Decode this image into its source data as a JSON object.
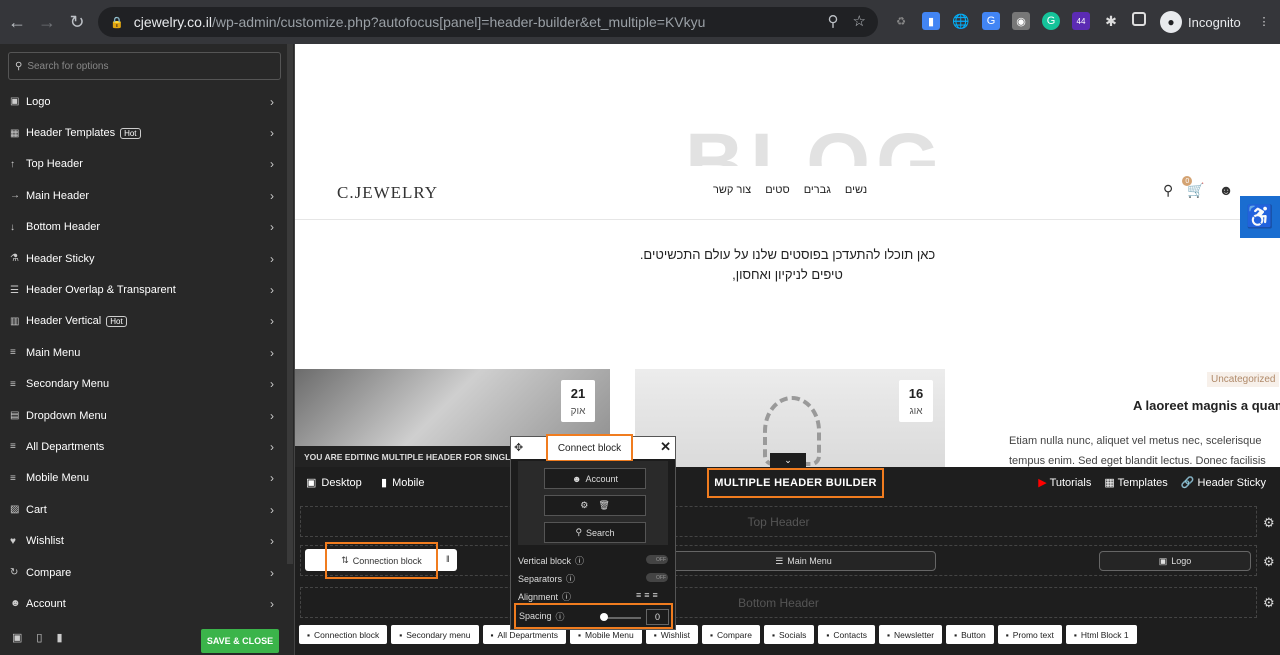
{
  "browser": {
    "url_host": "cjewelry.co.il",
    "url_path": "/wp-admin/customize.php?autofocus[panel]=header-builder&et_multiple=KVkyu",
    "profile_label": "Incognito",
    "ext_badge": "44"
  },
  "sidebar": {
    "search_placeholder": "Search for options",
    "items": [
      {
        "label": "Logo",
        "icon": "image-icon"
      },
      {
        "label": "Header Templates",
        "icon": "grid-icon",
        "badge": "Hot"
      },
      {
        "label": "Top Header",
        "icon": "arrow-up-icon"
      },
      {
        "label": "Main Header",
        "icon": "arrow-right-icon"
      },
      {
        "label": "Bottom Header",
        "icon": "arrow-down-icon"
      },
      {
        "label": "Header Sticky",
        "icon": "link-icon"
      },
      {
        "label": "Header Overlap & Transparent",
        "icon": "layers-icon"
      },
      {
        "label": "Header Vertical",
        "icon": "columns-icon",
        "badge": "Hot"
      },
      {
        "label": "Main Menu",
        "icon": "bars-icon"
      },
      {
        "label": "Secondary Menu",
        "icon": "bars-icon"
      },
      {
        "label": "Dropdown Menu",
        "icon": "dropdown-icon"
      },
      {
        "label": "All Departments",
        "icon": "bars-icon"
      },
      {
        "label": "Mobile Menu",
        "icon": "bars-icon"
      },
      {
        "label": "Cart",
        "icon": "cart-icon"
      },
      {
        "label": "Wishlist",
        "icon": "heart-icon"
      },
      {
        "label": "Compare",
        "icon": "sync-icon"
      },
      {
        "label": "Account",
        "icon": "user-icon"
      }
    ],
    "save_label": "SAVE & CLOSE"
  },
  "site": {
    "bg_word": "BLOG",
    "logo": "C.JEWELRY",
    "nav": [
      "נשים",
      "גברים",
      "סטים",
      "צור קשר"
    ],
    "cart_count": "0",
    "intro_line1": "כאן תוכלו להתעדכן בפוסטים שלנו על עולם התכשיטים.",
    "intro_line2": "טיפים לניקיון ואחסון,",
    "post1_day": "21",
    "post1_month": "אוק",
    "post2_day": "16",
    "post2_month": "אוג",
    "category": "Uncategorized",
    "post_title": "A laoreet magnis a quam",
    "excerpt1": "Etiam nulla nunc, aliquet vel metus nec, scelerisque",
    "excerpt2": "tempus enim. Sed eget blandit lectus. Donec facilisis"
  },
  "builder": {
    "editing_notice": "YOU ARE EDITING MULTIPLE HEADER FOR SINGLE",
    "desktop": "Desktop",
    "mobile": "Mobile",
    "title": "MULTIPLE HEADER BUILDER",
    "tutorials": "Tutorials",
    "templates": "Templates",
    "header_sticky": "Header Sticky",
    "top_header": "Top Header",
    "bottom_header": "Bottom Header",
    "connection_block": "Connection block",
    "main_menu": "Main Menu",
    "logo": "Logo",
    "tray": [
      "Connection block",
      "Secondary menu",
      "All Departments",
      "Mobile Menu",
      "Wishlist",
      "Compare",
      "Socials",
      "Contacts",
      "Newsletter",
      "Button",
      "Promo text",
      "Html Block 1"
    ]
  },
  "popup": {
    "title": "Connect block",
    "account": "Account",
    "search": "Search",
    "vertical_block": "Vertical block",
    "separators": "Separators",
    "alignment": "Alignment",
    "spacing": "Spacing",
    "spacing_value": "0",
    "toggle_off": "OFF"
  }
}
